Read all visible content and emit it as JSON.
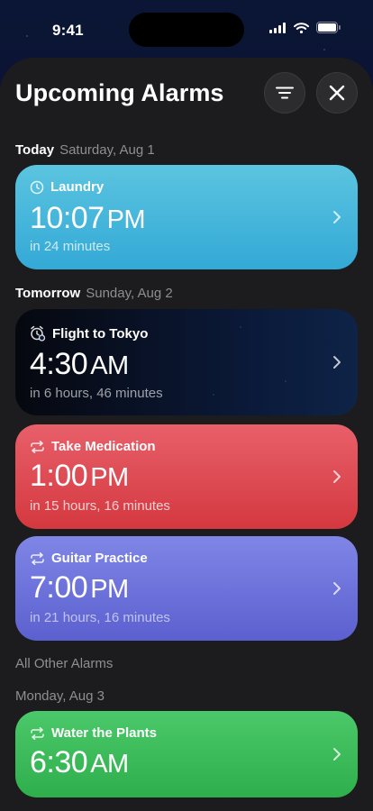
{
  "status_bar": {
    "time": "9:41"
  },
  "header": {
    "title": "Upcoming Alarms"
  },
  "sections": {
    "today": {
      "label": "Today",
      "date": "Saturday, Aug 1"
    },
    "tomorrow": {
      "label": "Tomorrow",
      "date": "Sunday, Aug 2"
    },
    "other": {
      "label": "All Other Alarms"
    },
    "monday": {
      "label": "Monday, Aug 3"
    }
  },
  "alarms": [
    {
      "name": "Laundry",
      "time": "10:07",
      "ampm": "PM",
      "relative": "in 24 minutes",
      "icon": "clock-icon",
      "color": "#45b8dc"
    },
    {
      "name": "Flight to Tokyo",
      "time": "4:30",
      "ampm": "AM",
      "relative": "in 6 hours, 46 minutes",
      "icon": "alarm-clock-icon",
      "color": "#0b1a3a"
    },
    {
      "name": "Take Medication",
      "time": "1:00",
      "ampm": "PM",
      "relative": "in 15 hours, 16 minutes",
      "icon": "repeat-icon",
      "color": "#de4a52"
    },
    {
      "name": "Guitar Practice",
      "time": "7:00",
      "ampm": "PM",
      "relative": "in 21 hours, 16 minutes",
      "icon": "repeat-icon",
      "color": "#6c72db"
    },
    {
      "name": "Water the Plants",
      "time": "6:30",
      "ampm": "AM",
      "relative": "",
      "icon": "repeat-icon",
      "color": "#3cbc5a"
    }
  ]
}
